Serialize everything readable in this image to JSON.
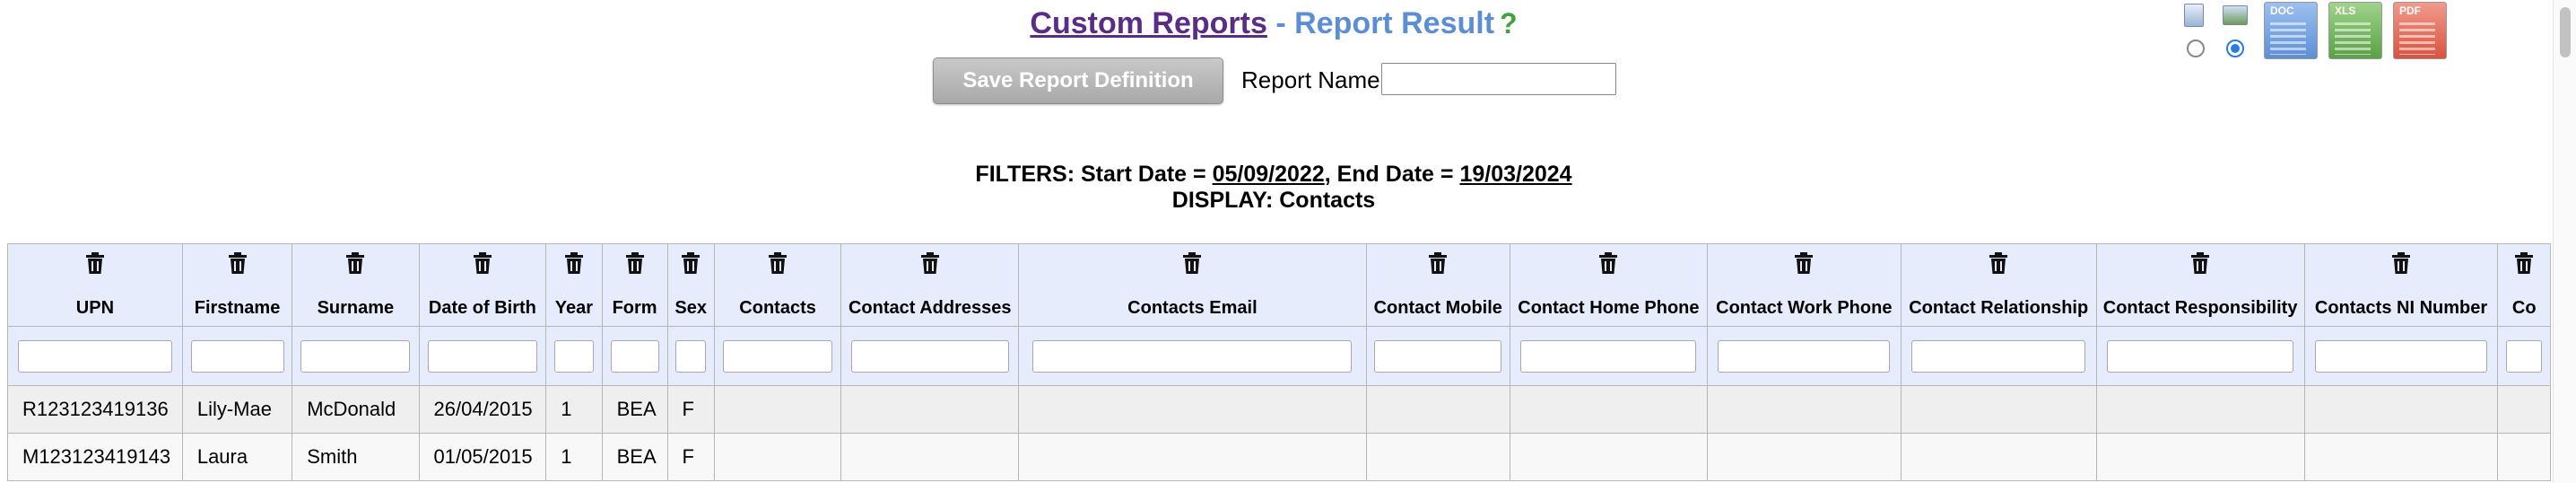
{
  "header": {
    "link_title": "Custom Reports",
    "separator": " - ",
    "subtitle": "Report Result",
    "help_glyph": "?",
    "save_button": "Save Report Definition",
    "report_name_label": "Report Name:",
    "report_name_value": ""
  },
  "filters": {
    "start_label": "FILTERS: Start Date = ",
    "start_date": "05/09/2022",
    "end_label": ",  End Date = ",
    "end_date": "19/03/2024",
    "display": "DISPLAY: Contacts"
  },
  "export": {
    "doc_label": "DOC",
    "xls_label": "XLS",
    "pdf_label": "PDF",
    "portrait_selected": false,
    "landscape_selected": true,
    "colors": {
      "doc": "#7aa7e6",
      "xls": "#6fb552",
      "pdf": "#e46a5a"
    }
  },
  "table": {
    "columns": [
      "UPN",
      "Firstname",
      "Surname",
      "Date of Birth",
      "Year",
      "Form",
      "Sex",
      "Contacts",
      "Contact Addresses",
      "Contacts Email",
      "Contact Mobile",
      "Contact Home Phone",
      "Contact Work Phone",
      "Contact Relationship",
      "Contact Responsibility",
      "Contacts NI Number",
      "Co"
    ],
    "rows": [
      [
        "R123123419136",
        "Lily-Mae",
        "McDonald",
        "26/04/2015",
        "1",
        "BEA",
        "F",
        "",
        "",
        "",
        "",
        "",
        "",
        "",
        "",
        "",
        ""
      ],
      [
        "M123123419143",
        "Laura",
        "Smith",
        "01/05/2015",
        "1",
        "BEA",
        "F",
        "",
        "",
        "",
        "",
        "",
        "",
        "",
        "",
        "",
        ""
      ]
    ]
  },
  "colors": {
    "header_bg": "#e6ecfb",
    "link": "#5a2c86",
    "accent": "#5b8ed6"
  }
}
